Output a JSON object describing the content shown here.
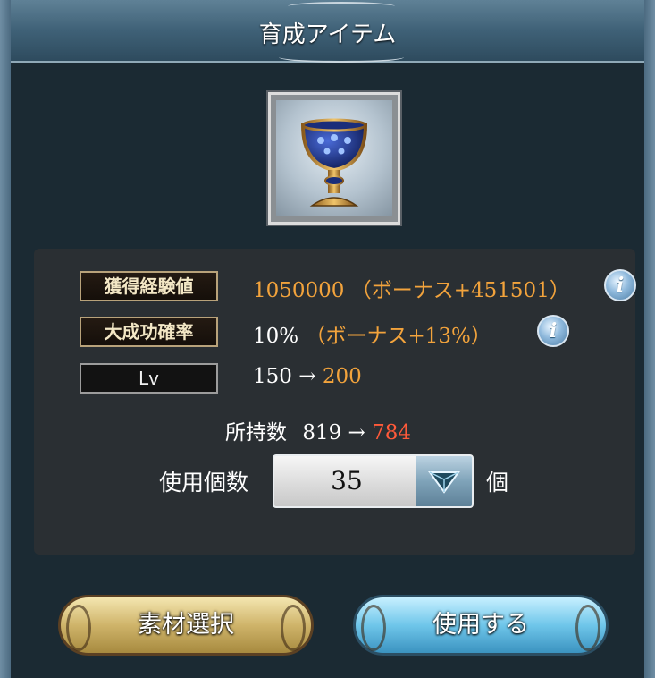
{
  "header": {
    "title": "育成アイテム"
  },
  "item": {
    "icon": "chalice-icon"
  },
  "stats": {
    "exp": {
      "label": "獲得経験値",
      "value": "1050000",
      "bonus": "（ボーナス+451501）"
    },
    "success": {
      "label": "大成功確率",
      "value": "10%",
      "bonus": "（ボーナス+13%）"
    },
    "level": {
      "label": "Lv",
      "from": "150",
      "arrow": "→",
      "to": "200"
    }
  },
  "owned": {
    "label": "所持数",
    "from": "819",
    "arrow": "→",
    "to": "784"
  },
  "use": {
    "label": "使用個数",
    "value": "35",
    "unit": "個"
  },
  "buttons": {
    "select_material": "素材選択",
    "use": "使用する"
  },
  "colors": {
    "accent_orange": "#f2a33c",
    "accent_red": "#ff5a3a",
    "label_gold": "#b8a27a"
  }
}
